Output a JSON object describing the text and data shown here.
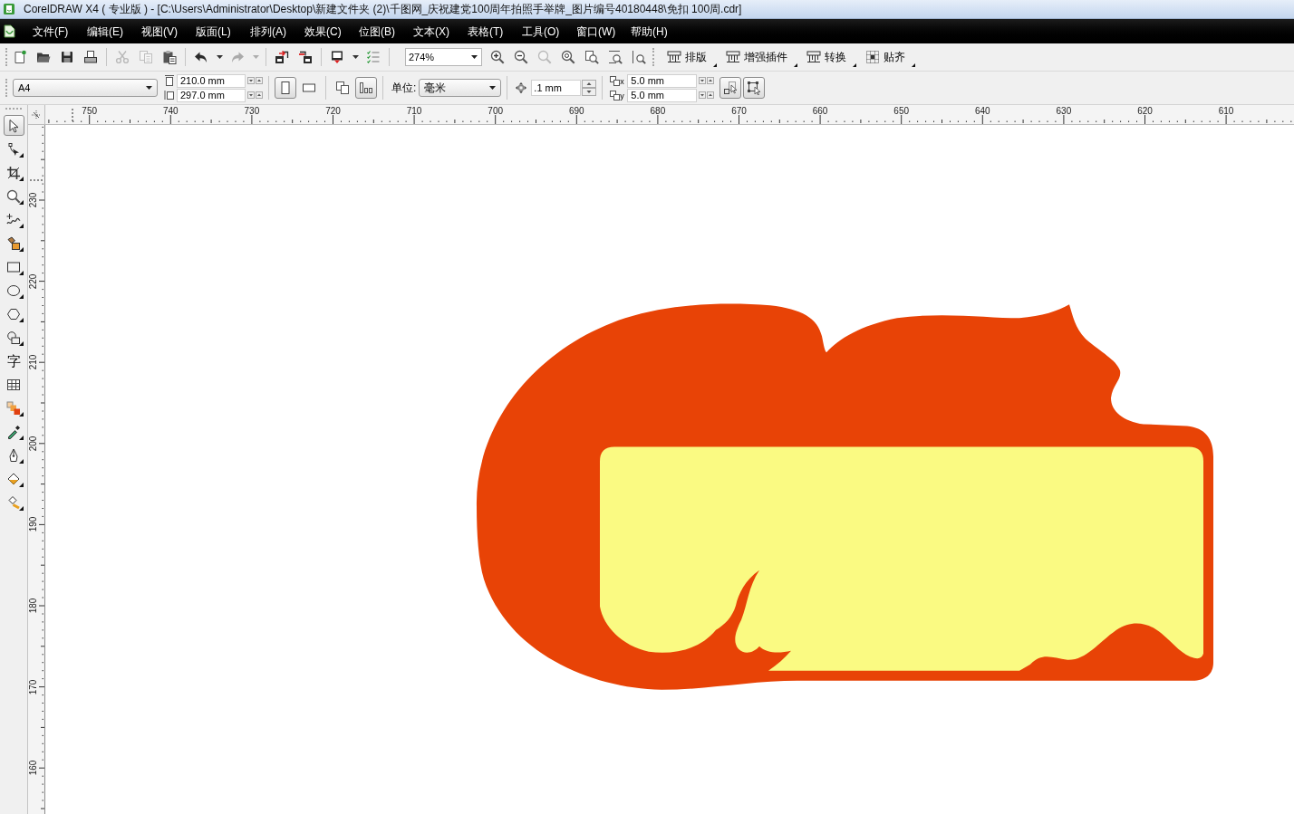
{
  "window": {
    "title": "CorelDRAW X4 ( 专业版 ) - [C:\\Users\\Administrator\\Desktop\\新建文件夹 (2)\\千图网_庆祝建党100周年拍照手举牌_图片编号40180448\\免扣 100周.cdr]"
  },
  "menu": {
    "items": [
      "文件(F)",
      "编辑(E)",
      "视图(V)",
      "版面(L)",
      "排列(A)",
      "效果(C)",
      "位图(B)",
      "文本(X)",
      "表格(T)",
      "工具(O)",
      "窗口(W)",
      "帮助(H)"
    ]
  },
  "standard_toolbar": {
    "groups": [
      [
        {
          "kind": "new",
          "disabled": false
        },
        {
          "kind": "open",
          "disabled": false
        },
        {
          "kind": "save",
          "disabled": false
        },
        {
          "kind": "print",
          "disabled": false
        }
      ],
      [
        {
          "kind": "cut",
          "disabled": true
        },
        {
          "kind": "copy",
          "disabled": true
        },
        {
          "kind": "paste",
          "disabled": false
        }
      ],
      [
        {
          "kind": "undo",
          "disabled": false
        },
        {
          "kind": "dropdown",
          "disabled": false
        },
        {
          "kind": "redo",
          "disabled": true
        },
        {
          "kind": "dropdown",
          "disabled": true
        }
      ],
      [
        {
          "kind": "import",
          "disabled": false
        },
        {
          "kind": "export",
          "disabled": false
        }
      ],
      [
        {
          "kind": "launcher",
          "disabled": false
        },
        {
          "kind": "dropdown",
          "disabled": false
        },
        {
          "kind": "options",
          "disabled": false
        }
      ]
    ],
    "zoom_level": "274%",
    "zoom_tools": [
      {
        "kind": "zoom-in",
        "disabled": false
      },
      {
        "kind": "zoom-out",
        "disabled": false
      },
      {
        "kind": "zoom-one-shot",
        "disabled": true
      },
      {
        "kind": "zoom-selected",
        "disabled": false
      },
      {
        "kind": "zoom-all",
        "disabled": false
      },
      {
        "kind": "zoom-page",
        "disabled": false
      },
      {
        "kind": "zoom-width",
        "disabled": false
      }
    ],
    "plugin_buttons": [
      {
        "kind": "layout",
        "label": "排版"
      },
      {
        "kind": "layout",
        "label": "增强插件"
      },
      {
        "kind": "layout",
        "label": "转换"
      },
      {
        "kind": "snap",
        "label": "贴齐"
      }
    ]
  },
  "property_bar": {
    "page_size": "A4",
    "width": "210.0 mm",
    "height": "297.0 mm",
    "orientation": [
      {
        "kind": "portrait",
        "selected": true
      },
      {
        "kind": "landscape",
        "selected": false
      }
    ],
    "page_scope": [
      {
        "kind": "all-pages",
        "selected": false
      },
      {
        "kind": "current-page",
        "selected": true
      }
    ],
    "unit_label": "单位:",
    "unit": "毫米",
    "nudge": ".1 mm",
    "duplicate": [
      {
        "axis": "x",
        "value": "5.0 mm"
      },
      {
        "axis": "y",
        "value": "5.0 mm"
      }
    ],
    "toggles": [
      {
        "kind": "fill-select",
        "on": true
      },
      {
        "kind": "frame-select",
        "on": true
      }
    ]
  },
  "toolbox": {
    "tools": [
      {
        "kind": "pick",
        "selected": true,
        "flyout": false
      },
      {
        "kind": "shape",
        "selected": false,
        "flyout": true
      },
      {
        "kind": "crop",
        "selected": false,
        "flyout": true
      },
      {
        "kind": "zoom",
        "selected": false,
        "flyout": true
      },
      {
        "kind": "freehand",
        "selected": false,
        "flyout": true
      },
      {
        "kind": "smart-fill",
        "selected": false,
        "flyout": true
      },
      {
        "kind": "rectangle",
        "selected": false,
        "flyout": true
      },
      {
        "kind": "ellipse",
        "selected": false,
        "flyout": true
      },
      {
        "kind": "polygon",
        "selected": false,
        "flyout": true
      },
      {
        "kind": "basic-shapes",
        "selected": false,
        "flyout": true
      },
      {
        "kind": "text",
        "label": "字",
        "selected": false,
        "flyout": false
      },
      {
        "kind": "table",
        "selected": false,
        "flyout": false
      },
      {
        "kind": "blend",
        "selected": false,
        "flyout": true
      },
      {
        "kind": "eyedropper",
        "selected": false,
        "flyout": true
      },
      {
        "kind": "outline",
        "selected": false,
        "flyout": true
      },
      {
        "kind": "fill",
        "selected": false,
        "flyout": true
      },
      {
        "kind": "interactive-fill",
        "selected": false,
        "flyout": true
      }
    ]
  },
  "rulers": {
    "horizontal": [
      "750",
      "740",
      "730",
      "720",
      "710",
      "700",
      "690",
      "680",
      "670",
      "660",
      "650",
      "640",
      "630",
      "620",
      "610"
    ],
    "vertical": [
      "230",
      "220",
      "210",
      "200",
      "190",
      "180",
      "170",
      "160"
    ]
  }
}
